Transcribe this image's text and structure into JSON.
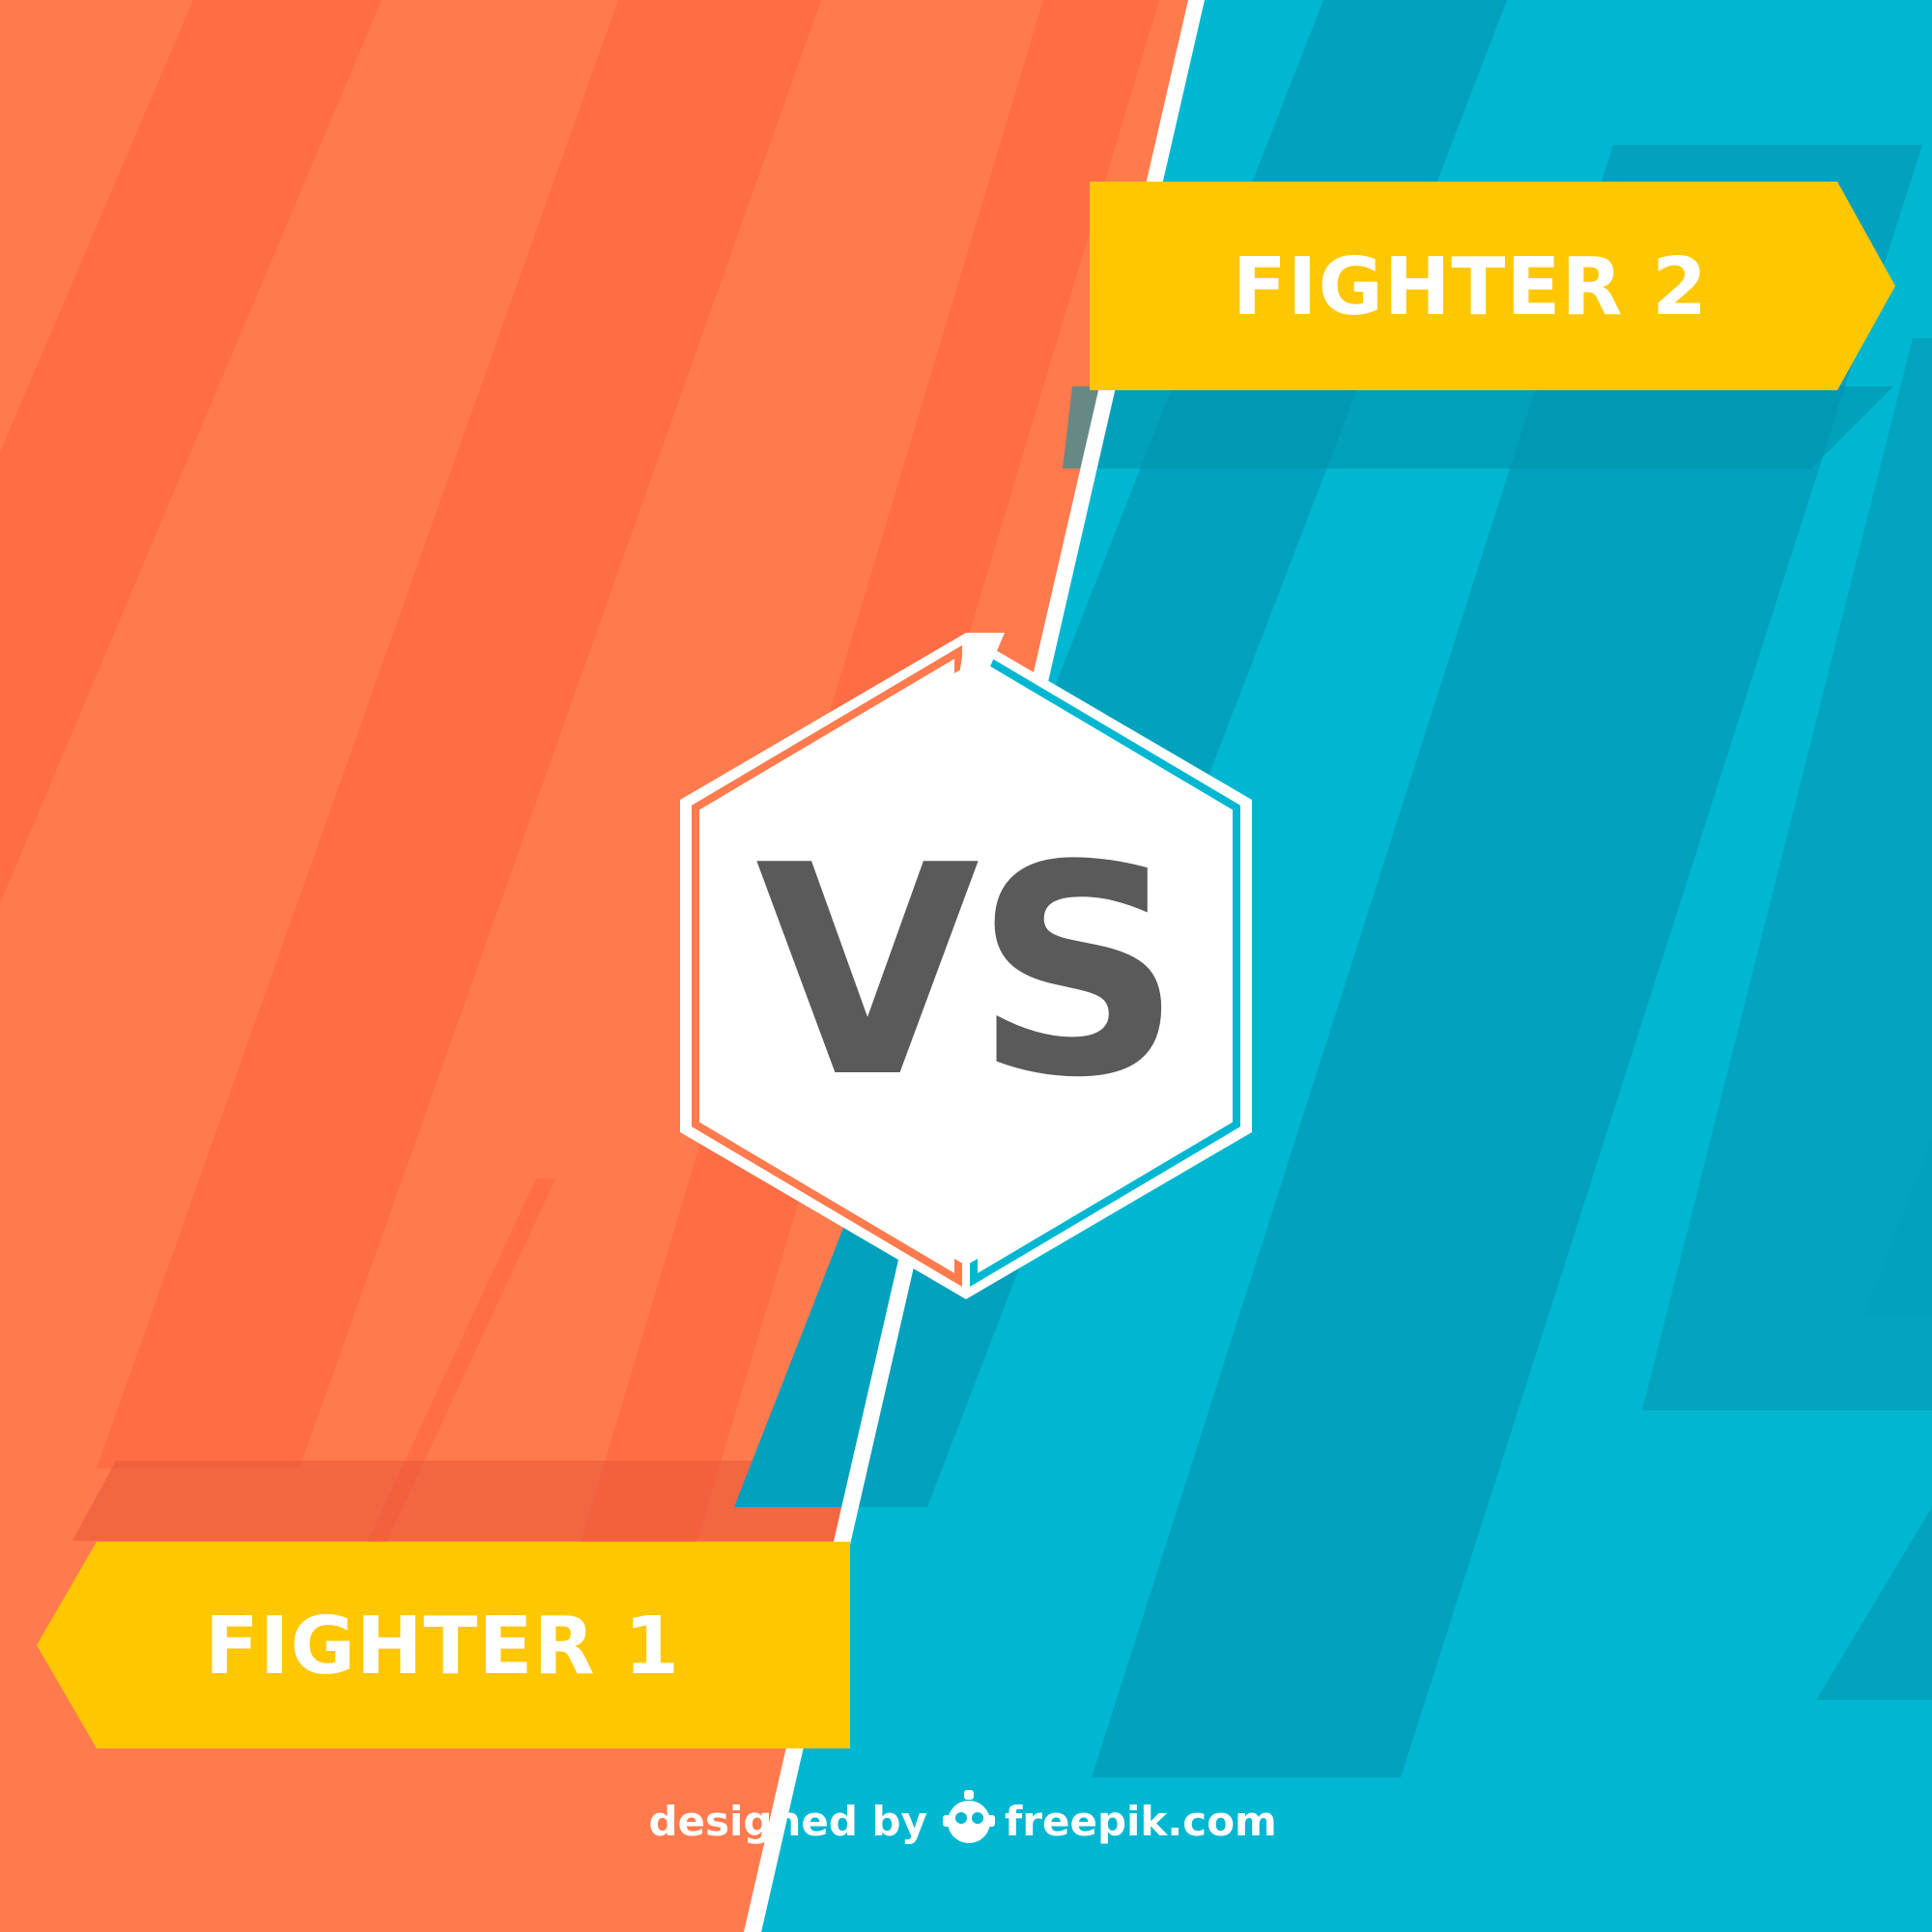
{
  "colors": {
    "orange": "#ff7a4d",
    "orange_stripe": "#ff6d44",
    "cyan": "#00b7d1",
    "cyan_stripe": "#02a1bd",
    "banner_yellow": "#ffc700",
    "divider_white": "#ffffff",
    "vs_gray": "#5a5a5a"
  },
  "vs": {
    "label": "VS",
    "icon": "hexagon-badge"
  },
  "fighter1": {
    "label": "FIGHTER 1",
    "arrow": "left"
  },
  "fighter2": {
    "label": "FIGHTER 2",
    "arrow": "right"
  },
  "credit": {
    "prefix": "designed by",
    "logo_icon": "freepik-robot-icon",
    "brand": "freepik.com"
  }
}
